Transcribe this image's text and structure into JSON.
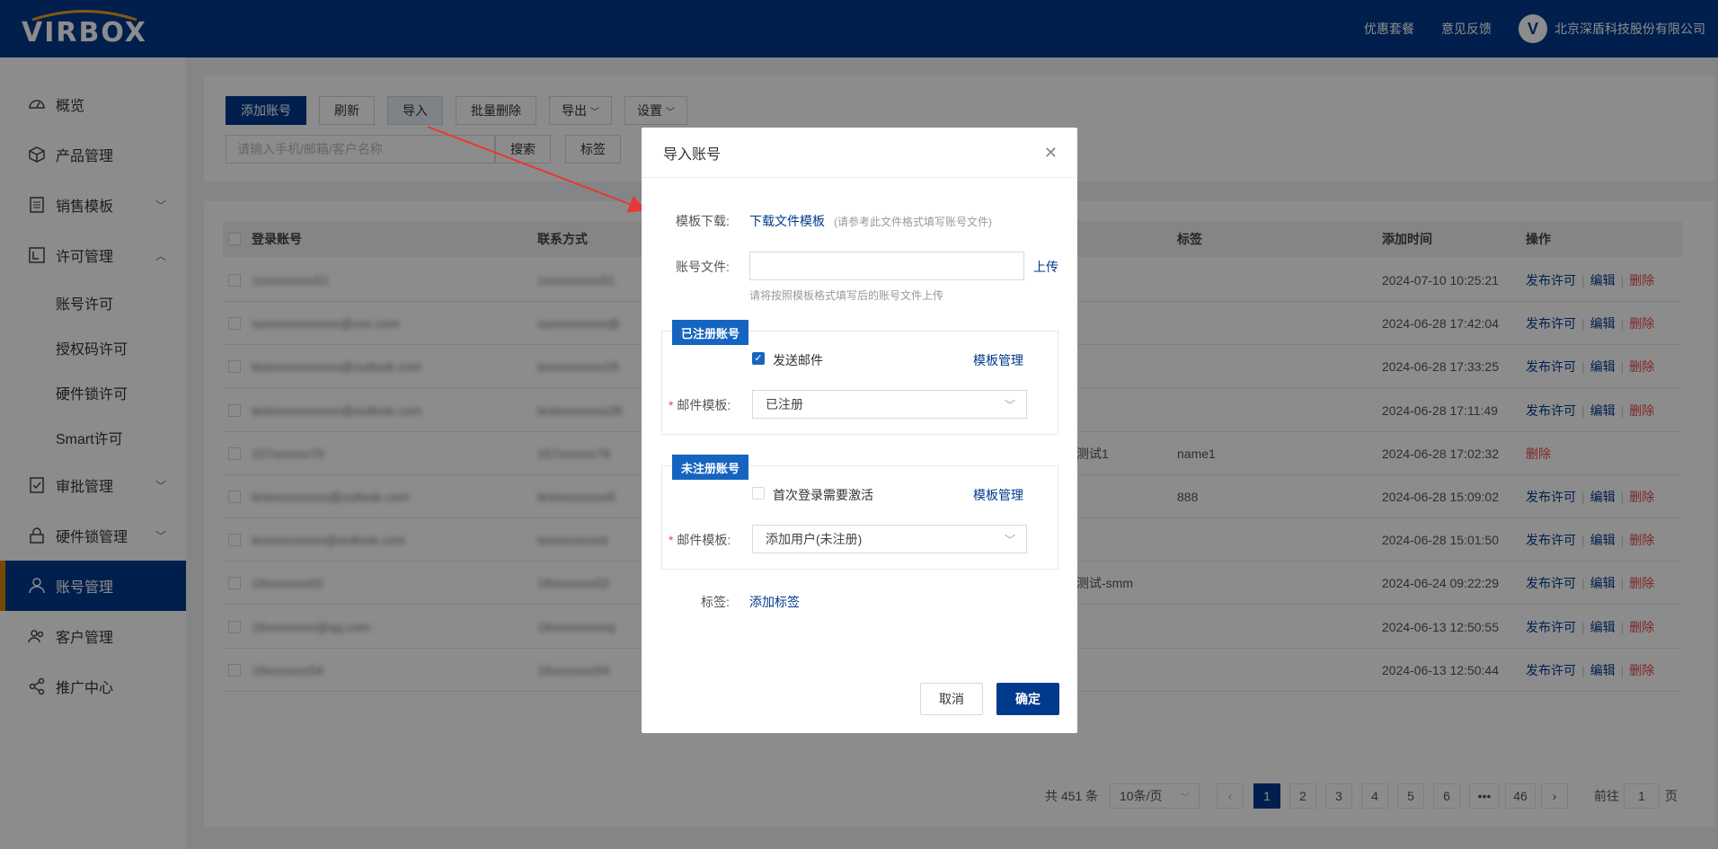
{
  "header": {
    "logo": "VIRBOX",
    "links": [
      "优惠套餐",
      "意见反馈"
    ],
    "company": "北京深盾科技股份有限公司"
  },
  "sidebar": {
    "items": [
      {
        "label": "概览",
        "icon": "dashboard-icon"
      },
      {
        "label": "产品管理",
        "icon": "cube-icon"
      },
      {
        "label": "销售模板",
        "icon": "list-icon"
      },
      {
        "label": "许可管理",
        "icon": "license-icon"
      },
      {
        "label": "审批管理",
        "icon": "approval-icon"
      },
      {
        "label": "硬件锁管理",
        "icon": "lock-icon"
      },
      {
        "label": "账号管理",
        "icon": "user-icon"
      },
      {
        "label": "客户管理",
        "icon": "customers-icon"
      },
      {
        "label": "推广中心",
        "icon": "share-icon"
      }
    ],
    "sub_items": [
      "账号许可",
      "授权码许可",
      "硬件锁许可",
      "Smart许可"
    ]
  },
  "toolbar": {
    "add": "添加账号",
    "refresh": "刷新",
    "import": "导入",
    "batch_delete": "批量删除",
    "export": "导出",
    "settings": "设置",
    "search_placeholder": "请输入手机/邮箱/客户名称",
    "search": "搜索",
    "tag": "标签"
  },
  "table": {
    "headers": [
      "登录账号",
      "联系方式",
      "标签",
      "添加时间",
      "操作"
    ],
    "rows": [
      {
        "account": "1xxxxxxxxx51",
        "contact": "1xxxxxxxxx51",
        "extra": "",
        "tag": "",
        "time": "2024-07-10 10:25:21",
        "ops": [
          "发布许可",
          "编辑",
          "删除"
        ]
      },
      {
        "account": "suxxxxxxxxxxxx@xxx.com",
        "contact": "suxxxxxxxxx@",
        "extra": "",
        "tag": "",
        "time": "2024-06-28 17:42:04",
        "ops": [
          "发布许可",
          "编辑",
          "删除"
        ]
      },
      {
        "account": "testxxxxxxxxxxx@outlook.com",
        "contact": "texxxxxxxxx28",
        "extra": "",
        "tag": "",
        "time": "2024-06-28 17:33:25",
        "ops": [
          "发布许可",
          "编辑",
          "删除"
        ]
      },
      {
        "account": "testxxxxxxxxxxx@outlook.com",
        "contact": "testxxxxxxxx28",
        "extra": "",
        "tag": "",
        "time": "2024-06-28 17:11:49",
        "ops": [
          "发布许可",
          "编辑",
          "删除"
        ]
      },
      {
        "account": "157xxxxxx79",
        "contact": "157xxxxxx79",
        "extra": "测试1",
        "tag": "name1",
        "time": "2024-06-28 17:02:32",
        "ops": [
          "删除"
        ]
      },
      {
        "account": "testxxxxxxxxx@outlook.com",
        "contact": "testxxxxxxxx8",
        "extra": "",
        "tag": "888",
        "time": "2024-06-28 15:09:02",
        "ops": [
          "发布许可",
          "编辑",
          "删除"
        ]
      },
      {
        "account": "texxxxxxxxxx@outlook.com",
        "contact": "texxxxxxxxst",
        "extra": "",
        "tag": "",
        "time": "2024-06-28 15:01:50",
        "ops": [
          "发布许可",
          "编辑",
          "删除"
        ]
      },
      {
        "account": "18xxxxxxx02",
        "contact": "18xxxxxxx02",
        "extra": "测试-smm",
        "tag": "",
        "time": "2024-06-24 09:22:29",
        "ops": [
          "发布许可",
          "编辑",
          "删除"
        ]
      },
      {
        "account": "16xxxxxxxx@qq.com",
        "contact": "16xxxxxxxxxq",
        "extra": "",
        "tag": "",
        "time": "2024-06-13 12:50:55",
        "ops": [
          "发布许可",
          "编辑",
          "删除"
        ]
      },
      {
        "account": "16xxxxxxx54",
        "contact": "16xxxxxxx54",
        "extra": "",
        "tag": "",
        "time": "2024-06-13 12:50:44",
        "ops": [
          "发布许可",
          "编辑",
          "删除"
        ]
      }
    ]
  },
  "pagination": {
    "total": "共 451 条",
    "page_size": "10条/页",
    "pages": [
      "1",
      "2",
      "3",
      "4",
      "5",
      "6",
      "•••",
      "46"
    ],
    "current": "1",
    "goto_prefix": "前往",
    "goto_value": "1",
    "goto_suffix": "页"
  },
  "modal": {
    "title": "导入账号",
    "template_label": "模板下载:",
    "template_link": "下载文件模板",
    "template_hint": "(请参考此文件格式填写账号文件)",
    "file_label": "账号文件:",
    "upload": "上传",
    "file_hint": "请将按照模板格式填写后的账号文件上传",
    "registered": {
      "badge": "已注册账号",
      "checkbox_label": "发送邮件",
      "checked": true,
      "manage": "模板管理",
      "select_label": "邮件模板:",
      "select_value": "已注册"
    },
    "unregistered": {
      "badge": "未注册账号",
      "checkbox_label": "首次登录需要激活",
      "checked": false,
      "manage": "模板管理",
      "select_label": "邮件模板:",
      "select_value": "添加用户(未注册)"
    },
    "tag_label": "标签:",
    "tag_link": "添加标签",
    "cancel": "取消",
    "confirm": "确定"
  },
  "colors": {
    "primary": "#003a8c",
    "badge": "#1565c0",
    "danger": "#e84749",
    "accent_bar": "#d48806",
    "annotation_arrow": "#e53935"
  }
}
